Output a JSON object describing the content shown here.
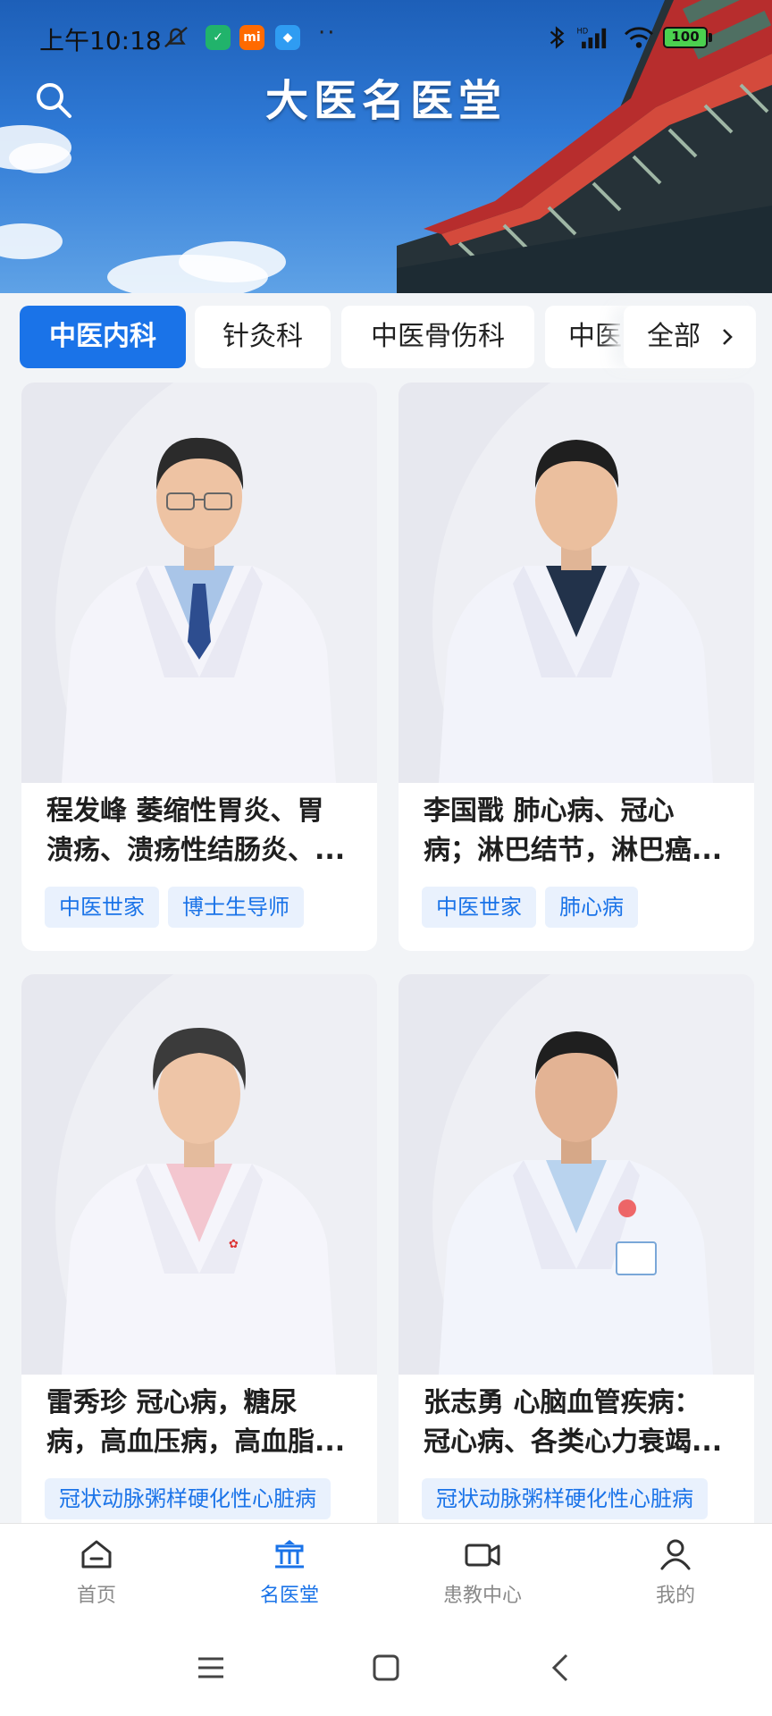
{
  "status_bar": {
    "time": "上午10:18",
    "app_chip_mi": "mi",
    "battery": "100",
    "dots": "··"
  },
  "header": {
    "title": "大医名医堂"
  },
  "category_tabs": {
    "items": [
      "中医内科",
      "针灸科",
      "中医骨伤科",
      "中医"
    ],
    "active_index": 0,
    "more_label": "全部"
  },
  "doctors": [
    {
      "name": "程发峰",
      "line1_rest": "萎缩性胃炎、胃",
      "line2": "溃疡、溃疡性结肠炎、...",
      "tags": [
        "中医世家",
        "博士生导师"
      ]
    },
    {
      "name": "李国戬",
      "line1_rest": "肺心病、冠心",
      "line2": "病；淋巴结节，淋巴癌...",
      "tags": [
        "中医世家",
        "肺心病"
      ]
    },
    {
      "name": "雷秀珍",
      "line1_rest": "冠心病，糖尿",
      "line2": "病，高血压病，高血脂...",
      "tags": [
        "冠状动脉粥样硬化性心脏病"
      ]
    },
    {
      "name": "张志勇",
      "line1_rest": "心脑血管疾病：",
      "line2": "冠心病、各类心力衰竭...",
      "tags": [
        "冠状动脉粥样硬化性心脏病"
      ]
    }
  ],
  "bottom_nav": {
    "items": [
      {
        "label": "首页",
        "icon": "home-icon"
      },
      {
        "label": "名医堂",
        "icon": "hall-icon"
      },
      {
        "label": "患教中心",
        "icon": "video-icon"
      },
      {
        "label": "我的",
        "icon": "user-icon"
      }
    ],
    "active_index": 1
  },
  "colors": {
    "accent": "#1a73e8",
    "tag_bg": "#e9f1fd",
    "page_bg": "#f2f4f7"
  }
}
